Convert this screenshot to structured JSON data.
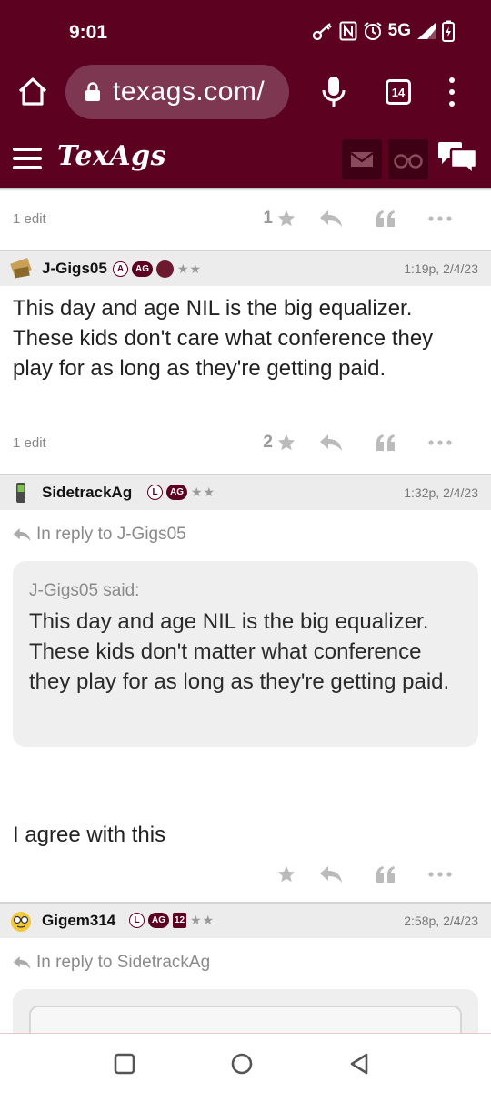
{
  "status": {
    "time": "9:01",
    "network": "5G"
  },
  "browser": {
    "url": "texags.com/",
    "tab_count": "14"
  },
  "site": {
    "logo": "TexAgs"
  },
  "post0": {
    "edit_note": "1 edit",
    "star_count": "1"
  },
  "post1": {
    "username": "J-Gigs05",
    "badges": [
      "A",
      "AG"
    ],
    "stars": "★★",
    "timestamp": "1:19p, 2/4/23",
    "body": "This day and age NIL is the big equalizer. These kids don't care what conference they play for as long as they're getting paid.",
    "edit_note": "1 edit",
    "star_count": "2"
  },
  "post2": {
    "username": "SidetrackAg",
    "badges": [
      "L",
      "AG"
    ],
    "stars": "★★",
    "timestamp": "1:32p, 2/4/23",
    "reply_to": "In reply to J-Gigs05",
    "quote_author": "J-Gigs05 said:",
    "quote_text": "This day and age NIL is the big equalizer. These kids don't matter what conference they play for as long as they're getting paid.",
    "body": "I agree with this"
  },
  "post3": {
    "username": "Gigem314",
    "badges": [
      "L",
      "AG",
      "12"
    ],
    "stars": "★★",
    "timestamp": "2:58p, 2/4/23",
    "reply_to": "In reply to SidetrackAg"
  },
  "colors": {
    "maroon": "#5c0120",
    "url_bg": "#7d3750",
    "icon_gray": "#aaaaaa"
  },
  "icons": [
    "home-icon",
    "lock-icon",
    "mic-icon",
    "tabs-icon",
    "more-vert-icon",
    "hamburger-icon",
    "mail-icon",
    "binoculars-icon",
    "chat-icon",
    "star-icon",
    "reply-icon",
    "quote-icon",
    "more-horiz-icon",
    "nav-square-icon",
    "nav-circle-icon",
    "nav-back-icon"
  ]
}
